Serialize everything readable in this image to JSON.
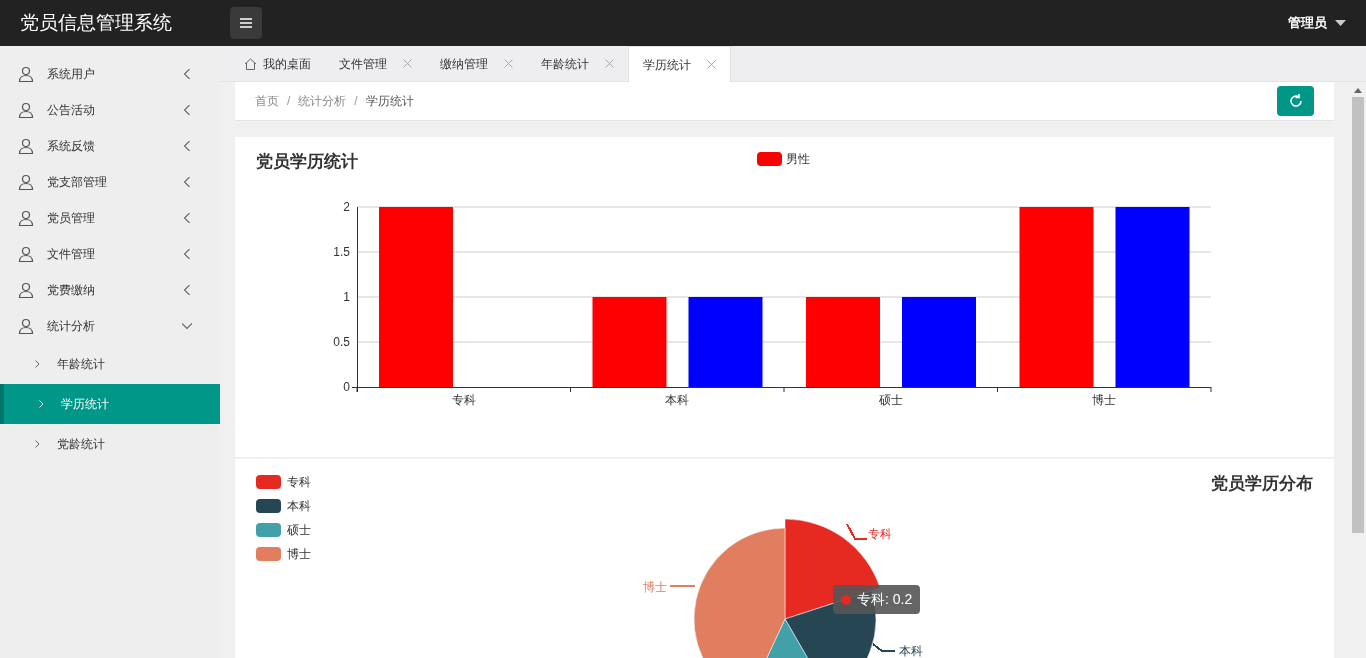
{
  "app_title": "党员信息管理系统",
  "user_menu": {
    "label": "管理员"
  },
  "sidebar": {
    "items": [
      {
        "label": "系统用户",
        "expanded": false
      },
      {
        "label": "公告活动",
        "expanded": false
      },
      {
        "label": "系统反馈",
        "expanded": false
      },
      {
        "label": "党支部管理",
        "expanded": false
      },
      {
        "label": "党员管理",
        "expanded": false
      },
      {
        "label": "文件管理",
        "expanded": false
      },
      {
        "label": "党费缴纳",
        "expanded": false
      },
      {
        "label": "统计分析",
        "expanded": true,
        "children": [
          {
            "label": "年龄统计",
            "selected": false
          },
          {
            "label": "学历统计",
            "selected": true
          },
          {
            "label": "党龄统计",
            "selected": false
          }
        ]
      }
    ]
  },
  "tabs": [
    {
      "label": "我的桌面",
      "kind": "home",
      "selected": false
    },
    {
      "label": "文件管理",
      "kind": "closable",
      "selected": false
    },
    {
      "label": "缴纳管理",
      "kind": "closable",
      "selected": false
    },
    {
      "label": "年龄统计",
      "kind": "closable",
      "selected": false
    },
    {
      "label": "学历统计",
      "kind": "closable",
      "selected": true
    }
  ],
  "breadcrumb": {
    "items": [
      "首页",
      "统计分析",
      "学历统计"
    ],
    "separators": [
      "/",
      "/"
    ]
  },
  "bar_panel": {
    "title": "党员学历统计",
    "chart_data": {
      "type": "bar",
      "categories": [
        "专科",
        "本科",
        "硕士",
        "博士"
      ],
      "yticks": [
        0,
        0.5,
        1,
        1.5,
        2
      ],
      "ylim": [
        0,
        2
      ],
      "grid": true,
      "series": [
        {
          "name": "男性",
          "color": "#ff0000",
          "values": [
            2,
            1,
            1,
            2
          ]
        },
        {
          "color": "#0000ff",
          "values": [
            0,
            1,
            1,
            2
          ]
        }
      ]
    }
  },
  "pie_panel": {
    "title": "党员学历分布",
    "legend": [
      {
        "label": "专科",
        "color": "#e62a22"
      },
      {
        "label": "本科",
        "color": "#264653"
      },
      {
        "label": "硕士",
        "color": "#41a0a8"
      },
      {
        "label": "博士",
        "color": "#e27e60"
      }
    ],
    "slice_labels": [
      {
        "label": "专科",
        "color": "#e62a22"
      },
      {
        "label": "本科",
        "color": "#264653"
      },
      {
        "label": "博士",
        "color": "#e27e60"
      }
    ],
    "tooltip": {
      "label": "专科: 0.2",
      "color": "#e62a22"
    }
  }
}
